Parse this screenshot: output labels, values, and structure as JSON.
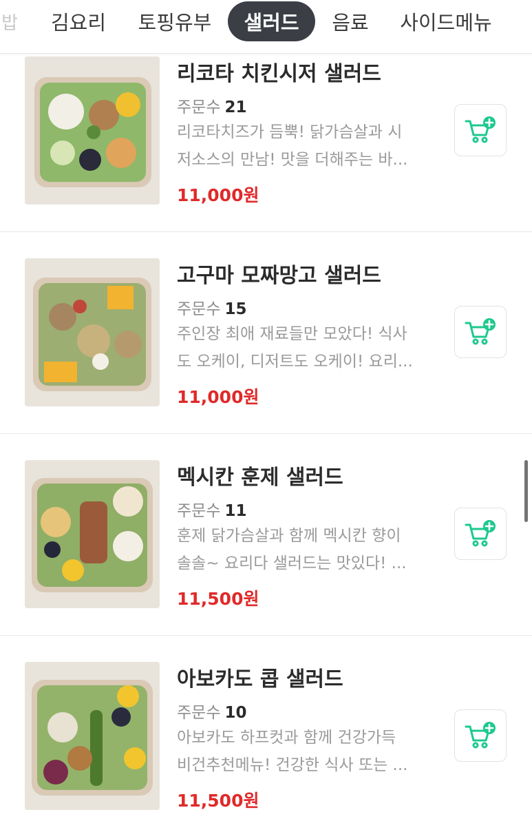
{
  "tabs": [
    {
      "label": "밥",
      "partial": true
    },
    {
      "label": "김요리"
    },
    {
      "label": "토핑유부"
    },
    {
      "label": "샐러드",
      "active": true
    },
    {
      "label": "음료"
    },
    {
      "label": "사이드메뉴"
    }
  ],
  "orders_label": "주문수",
  "items": [
    {
      "name": "리코타 치킨시저 샐러드",
      "orders": "21",
      "desc_line1": "리코타치즈가 듬뿍! 닭가슴살과 시",
      "desc_line2": "저소스의 만남! 맛을 더해주는 바...",
      "price": "11,000원"
    },
    {
      "name": "고구마 모짜망고 샐러드",
      "orders": "15",
      "desc_line1": "주인장 최애 재료들만 모았다! 식사",
      "desc_line2": "도 오케이, 디저트도 오케이! 요리...",
      "price": "11,000원"
    },
    {
      "name": "멕시칸 훈제 샐러드",
      "orders": "11",
      "desc_line1": "훈제 닭가슴살과 함께 멕시칸 향이",
      "desc_line2": "솔솔~ 요리다 샐러드는 맛있다! ...",
      "price": "11,500원"
    },
    {
      "name": "아보카도 콥 샐러드",
      "orders": "10",
      "desc_line1": "아보카도 하프컷과 함께 건강가득",
      "desc_line2": "비건추천메뉴! 건강한 식사 또는 ...",
      "price": "11,500원"
    }
  ],
  "icons": {
    "cart": "cart-plus-icon"
  },
  "colors": {
    "accent_green": "#1dc98d",
    "price_red": "#e02a2a",
    "active_tab_bg": "#3b3f45"
  }
}
